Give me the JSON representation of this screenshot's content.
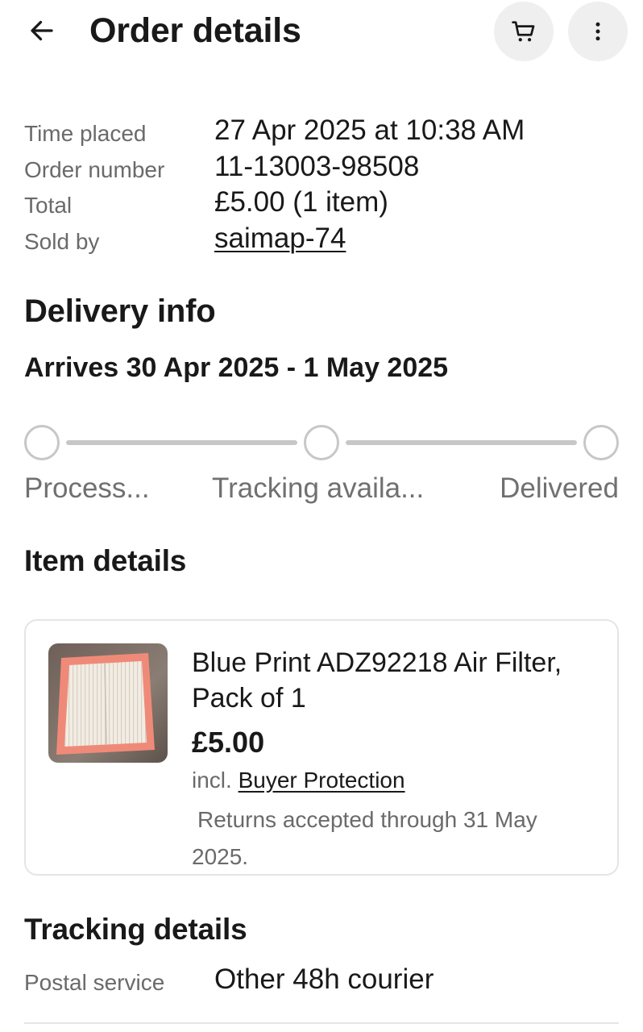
{
  "header": {
    "title": "Order details",
    "back_icon": "arrow-left-icon",
    "cart_icon": "cart-icon",
    "more_icon": "more-vertical-icon"
  },
  "summary": [
    {
      "label": "Time placed",
      "value": "27 Apr 2025 at 10:38 AM"
    },
    {
      "label": "Order number",
      "value": "11-13003-98508"
    },
    {
      "label": "Total",
      "value": "£5.00 (1 item)"
    },
    {
      "label": "Sold by",
      "value": "saimap-74"
    }
  ],
  "delivery": {
    "heading": "Delivery info",
    "arrives": "Arrives 30 Apr 2025 - 1 May 2025",
    "steps": [
      {
        "label": "Process...",
        "completed": false
      },
      {
        "label": "Tracking availa...",
        "completed": false
      },
      {
        "label": "Delivered",
        "completed": false
      }
    ]
  },
  "item_details": {
    "heading": "Item details",
    "item": {
      "title": "Blue Print ADZ92218 Air Filter, Pack of 1",
      "price": "£5.00",
      "incl_prefix": "incl.",
      "buyer_protection": "Buyer Protection",
      "returns": "Returns accepted through 31 May 2025."
    }
  },
  "tracking": {
    "heading": "Tracking details",
    "label": "Postal service",
    "value": "Other 48h courier"
  },
  "colors": {
    "text": "#191919",
    "muted": "#6a6a6a",
    "progress_inactive": "#c7c7c7",
    "button_bg": "#efefef",
    "border": "#e5e5e5"
  }
}
